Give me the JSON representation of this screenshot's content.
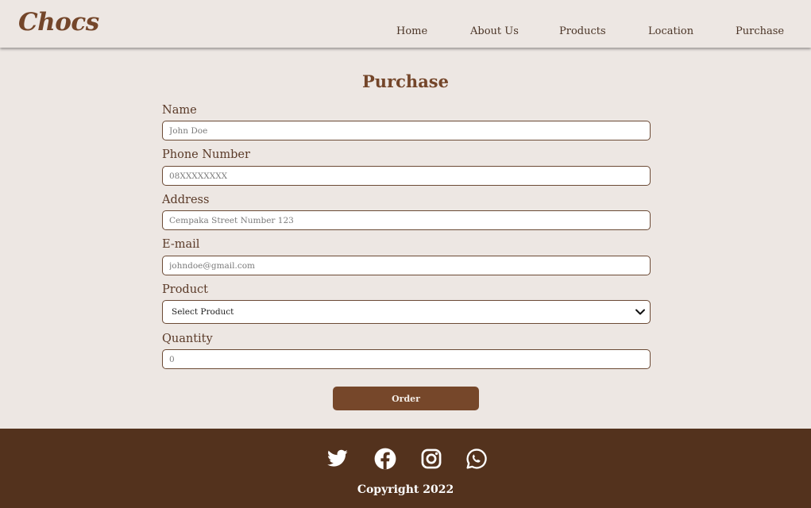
{
  "brand": "Chocs",
  "nav": {
    "home": "Home",
    "about": "About Us",
    "products": "Products",
    "location": "Location",
    "purchase": "Purchase"
  },
  "page_title": "Purchase",
  "form": {
    "name": {
      "label": "Name",
      "placeholder": "John Doe"
    },
    "phone": {
      "label": "Phone Number",
      "placeholder": "08XXXXXXXX"
    },
    "address": {
      "label": "Address",
      "placeholder": "Cempaka Street Number 123"
    },
    "email": {
      "label": "E-mail",
      "placeholder": "johndoe@gmail.com"
    },
    "product": {
      "label": "Product",
      "selected": "Select Product"
    },
    "quantity": {
      "label": "Quantity",
      "placeholder": "0"
    },
    "submit_label": "Order"
  },
  "footer": {
    "social_icons": [
      "twitter-icon",
      "facebook-icon",
      "instagram-icon",
      "whatsapp-icon"
    ],
    "copyright": "Copyright 2022"
  },
  "colors": {
    "background": "#ede7e3",
    "brand": "#74462a",
    "button": "#76472a",
    "footer": "#53321d"
  }
}
